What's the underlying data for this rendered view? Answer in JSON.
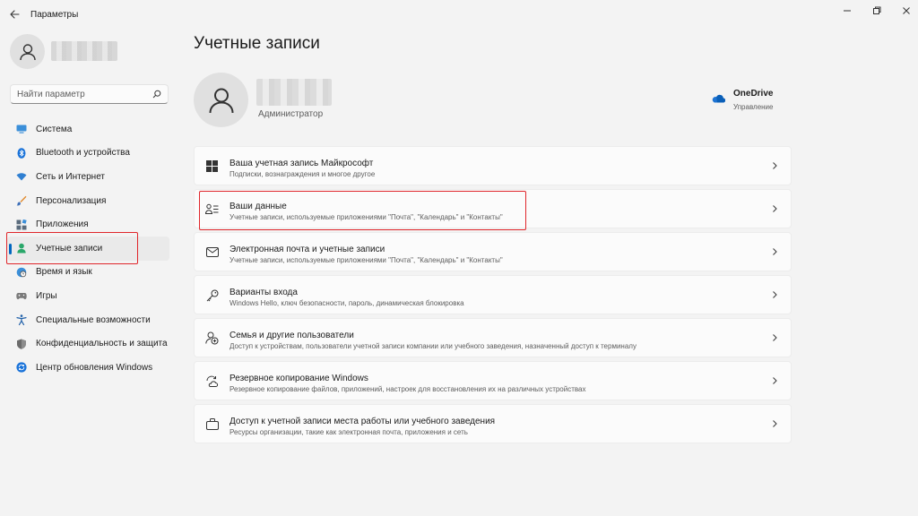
{
  "window": {
    "title": "Параметры"
  },
  "sidebar": {
    "search_placeholder": "Найти параметр",
    "items": [
      {
        "label": "Система",
        "icon": "monitor-icon",
        "color": "#0078d4"
      },
      {
        "label": "Bluetooth и устройства",
        "icon": "bluetooth-icon",
        "color": "#0078d4"
      },
      {
        "label": "Сеть и Интернет",
        "icon": "wifi-icon",
        "color": "#0067c0"
      },
      {
        "label": "Персонализация",
        "icon": "brush-icon",
        "color": "#e08a2e"
      },
      {
        "label": "Приложения",
        "icon": "apps-icon",
        "color": "#5a6b7c"
      },
      {
        "label": "Учетные записи",
        "icon": "person-icon",
        "color": "#2aa76a",
        "active": true
      },
      {
        "label": "Время и язык",
        "icon": "globe-clock-icon",
        "color": "#0078d4"
      },
      {
        "label": "Игры",
        "icon": "gamepad-icon",
        "color": "#7a7a7a"
      },
      {
        "label": "Специальные возможности",
        "icon": "accessibility-icon",
        "color": "#1f5fa8"
      },
      {
        "label": "Конфиденциальность и защита",
        "icon": "shield-icon",
        "color": "#7a7a7a"
      },
      {
        "label": "Центр обновления Windows",
        "icon": "update-icon",
        "color": "#0078d4"
      }
    ]
  },
  "main": {
    "title": "Учетные записи",
    "profile": {
      "role": "Администратор"
    },
    "onedrive": {
      "title": "OneDrive",
      "subtitle": "Управление",
      "color": "#0364b8"
    },
    "cards": [
      {
        "title": "Ваша учетная запись Майкрософт",
        "subtitle": "Подписки, вознаграждения и многое другое",
        "icon": "microsoft-logo-icon"
      },
      {
        "title": "Ваши данные",
        "subtitle": "Учетные записи, используемые приложениями \"Почта\", \"Календарь\" и \"Контакты\"",
        "icon": "person-list-icon"
      },
      {
        "title": "Электронная почта и учетные записи",
        "subtitle": "Учетные записи, используемые приложениями \"Почта\", \"Календарь\" и \"Контакты\"",
        "icon": "mail-icon"
      },
      {
        "title": "Варианты входа",
        "subtitle": "Windows Hello, ключ безопасности, пароль, динамическая блокировка",
        "icon": "key-icon"
      },
      {
        "title": "Семья и другие пользователи",
        "subtitle": "Доступ к устройствам, пользователи учетной записи компании или учебного заведения, назначенный доступ к терминалу",
        "icon": "family-icon"
      },
      {
        "title": "Резервное копирование Windows",
        "subtitle": "Резервное копирование файлов, приложений, настроек для восстановления их на различных устройствах",
        "icon": "backup-icon"
      },
      {
        "title": "Доступ к учетной записи места работы или учебного заведения",
        "subtitle": "Ресурсы организации, такие как электронная почта, приложения и сеть",
        "icon": "briefcase-icon"
      }
    ]
  },
  "highlight_color": "#e0262b"
}
